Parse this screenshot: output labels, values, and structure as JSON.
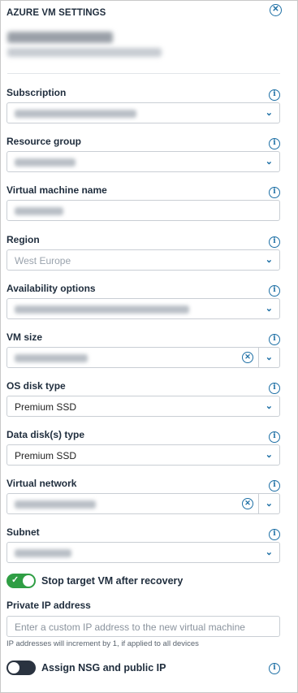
{
  "panel": {
    "title": "AZURE VM SETTINGS",
    "close_icon": "close-circle-icon"
  },
  "fields": {
    "subscription": {
      "label": "Subscription"
    },
    "resource_group": {
      "label": "Resource group"
    },
    "vm_name": {
      "label": "Virtual machine name"
    },
    "region": {
      "label": "Region",
      "value": "West Europe"
    },
    "availability": {
      "label": "Availability options"
    },
    "vm_size": {
      "label": "VM size"
    },
    "os_disk": {
      "label": "OS disk type",
      "value": "Premium SSD"
    },
    "data_disk": {
      "label": "Data disk(s) type",
      "value": "Premium SSD"
    },
    "vnet": {
      "label": "Virtual network"
    },
    "subnet": {
      "label": "Subnet"
    }
  },
  "toggles": {
    "stop_vm": {
      "label": "Stop target VM after recovery",
      "state": "on"
    },
    "nsg": {
      "label": "Assign NSG and public IP",
      "state": "off"
    }
  },
  "private_ip": {
    "label": "Private IP address",
    "placeholder": "Enter a custom IP address to the new virtual machine",
    "hint": "IP addresses will increment by 1, if applied to all devices"
  },
  "colors": {
    "accent": "#1d6fa5",
    "toggle_on": "#2f9e44",
    "toggle_off": "#2a3340"
  }
}
